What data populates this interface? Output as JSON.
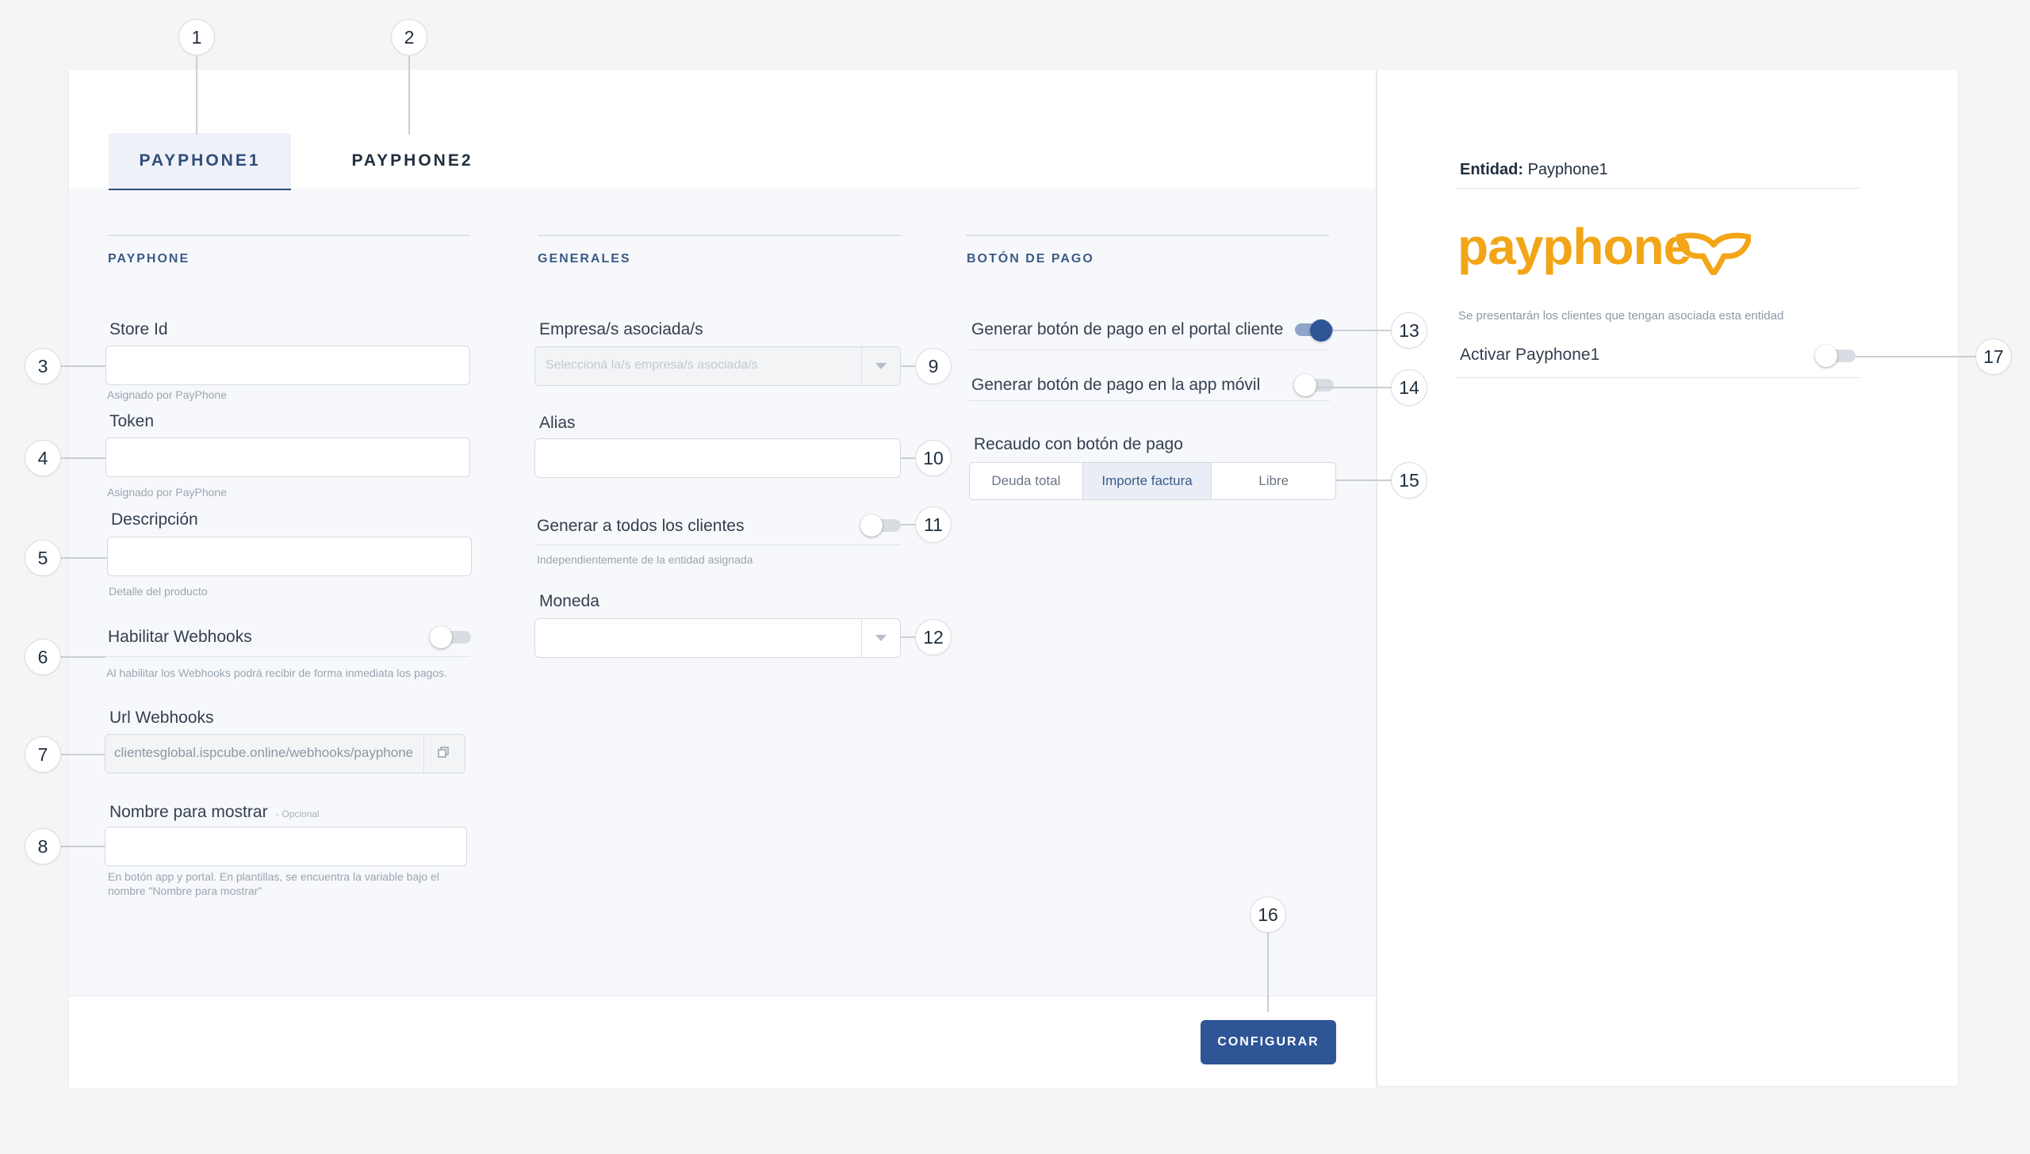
{
  "tabs": [
    {
      "label": "PAYPHONE1",
      "active": true
    },
    {
      "label": "PAYPHONE2",
      "active": false
    }
  ],
  "sections": {
    "payphone": {
      "title": "PAYPHONE",
      "store_id": {
        "label": "Store Id",
        "value": "",
        "help": "Asignado por PayPhone"
      },
      "token": {
        "label": "Token",
        "value": "",
        "help": "Asignado por PayPhone"
      },
      "descripcion": {
        "label": "Descripción",
        "value": "",
        "help": "Detalle del producto"
      },
      "webhooks": {
        "label": "Habilitar Webhooks",
        "enabled": false,
        "help": "Al habilitar los Webhooks podrá recibir de forma inmediata los pagos."
      },
      "url_webhooks": {
        "label": "Url Webhooks",
        "value": "clientesglobal.ispcube.online/webhooks/payphone"
      },
      "nombre_mostrar": {
        "label": "Nombre para mostrar",
        "optional": "- Opcional",
        "value": "",
        "help": "En botón app y portal. En plantillas, se encuentra la variable bajo el nombre \"Nombre para mostrar\""
      }
    },
    "generales": {
      "title": "GENERALES",
      "empresas": {
        "label": "Empresa/s asociada/s",
        "placeholder": "Seleccioná la/s empresa/s asociada/s"
      },
      "alias": {
        "label": "Alias",
        "value": ""
      },
      "generar_todos": {
        "label": "Generar a todos los clientes",
        "enabled": false,
        "help": "Independientemente de la entidad asignada"
      },
      "moneda": {
        "label": "Moneda",
        "value": ""
      }
    },
    "boton_pago": {
      "title": "BOTÓN DE PAGO",
      "portal_cliente": {
        "label": "Generar botón de pago en el portal cliente",
        "enabled": true
      },
      "app_movil": {
        "label": "Generar botón de pago en la app móvil",
        "enabled": false
      },
      "recaudo": {
        "label": "Recaudo con botón de pago",
        "options": [
          "Deuda total",
          "Importe factura",
          "Libre"
        ],
        "selected": "Importe factura"
      }
    }
  },
  "footer": {
    "configurar_label": "CONFIGURAR"
  },
  "sidebar": {
    "entidad_label": "Entidad:",
    "entidad_value": "Payphone1",
    "logo_text": "payphone",
    "note": "Se presentarán los clientes que tengan asociada esta entidad",
    "activar_label": "Activar Payphone1",
    "activar_enabled": false
  },
  "callouts": [
    "1",
    "2",
    "3",
    "4",
    "5",
    "6",
    "7",
    "8",
    "9",
    "10",
    "11",
    "12",
    "13",
    "14",
    "15",
    "16",
    "17"
  ],
  "colors": {
    "accent": "#2f5596",
    "brand": "#f2a516",
    "section_title": "#3b5b86"
  }
}
